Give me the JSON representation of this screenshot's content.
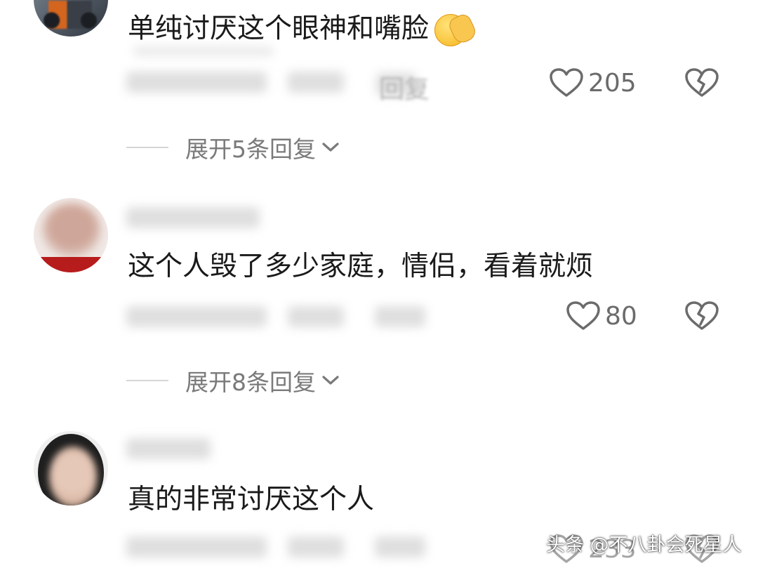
{
  "comments": [
    {
      "text": "单纯讨厌这个眼神和嘴脸",
      "emoji_icon": "face-palm-emoji",
      "reply_label": "回复",
      "likes": "205",
      "expand_label": "展开5条回复"
    },
    {
      "text": "这个人毁了多少家庭，情侣，看着就烦",
      "likes": "80",
      "expand_label": "展开8条回复"
    },
    {
      "text": "真的非常讨厌这个人",
      "likes": "233"
    }
  ],
  "watermark": "头条 @不八卦会死星人",
  "icons": {
    "like": "heart-outline-icon",
    "dislike": "broken-heart-icon",
    "expand": "chevron-down-icon"
  },
  "colors": {
    "text": "#1a1a1a",
    "muted": "#6b6b6b",
    "background": "#ffffff"
  }
}
